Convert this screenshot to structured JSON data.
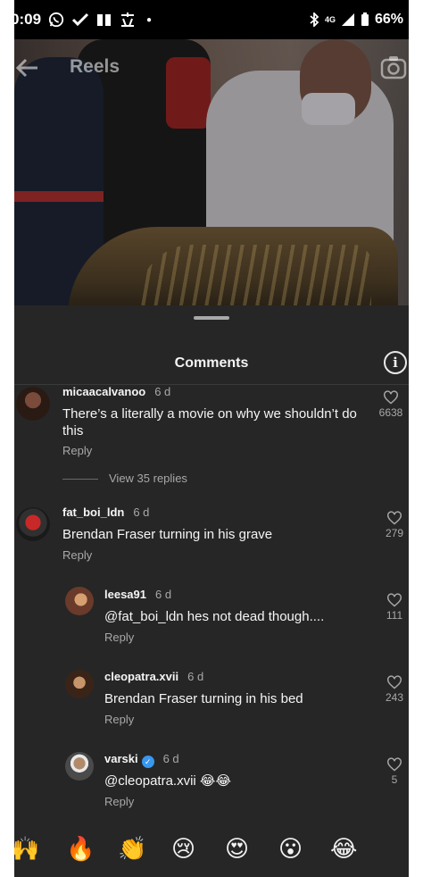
{
  "status_bar": {
    "time": "0:09",
    "network": "4G",
    "battery": "66%"
  },
  "header": {
    "title": "Reels"
  },
  "sheet": {
    "title": "Comments"
  },
  "comments": [
    {
      "username": "micaacalvanoo",
      "age": "6 d",
      "text": "There’s a literally a movie on why we shouldn’t do this",
      "reply_label": "Reply",
      "likes": "6638",
      "view_replies": "View 35 replies"
    },
    {
      "username": "fat_boi_ldn",
      "age": "6 d",
      "text": "Brendan Fraser turning in his grave",
      "reply_label": "Reply",
      "likes": "279"
    }
  ],
  "replies": [
    {
      "username": "leesa91",
      "age": "6 d",
      "text": "@fat_boi_ldn hes not dead though....",
      "reply_label": "Reply",
      "likes": "111"
    },
    {
      "username": "cleopatra.xvii",
      "age": "6 d",
      "text": "Brendan Fraser turning in his bed",
      "reply_label": "Reply",
      "likes": "243"
    },
    {
      "username": "varski",
      "age": "6 d",
      "verified": true,
      "text": "@cleopatra.xvii 😂😂",
      "reply_label": "Reply",
      "likes": "5"
    }
  ],
  "emoji_bar": [
    "🙌",
    "🔥",
    "👏",
    "😢",
    "😍",
    "😮",
    "😂"
  ],
  "colors": {
    "background": "#262626",
    "text_primary": "#f5f5f5",
    "text_secondary": "#a8a8a8",
    "verified": "#3897f0"
  }
}
